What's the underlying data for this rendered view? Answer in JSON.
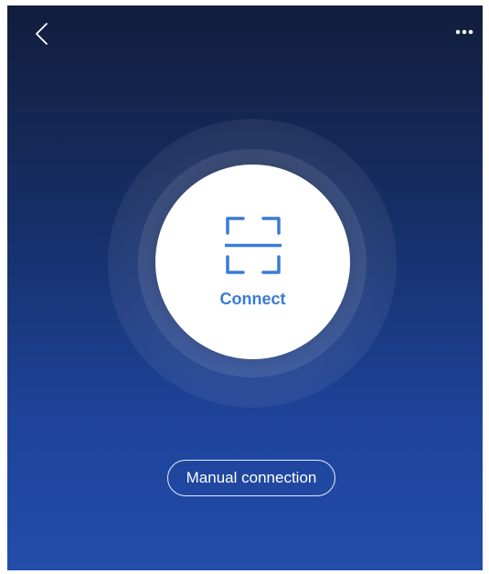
{
  "header": {
    "back_icon": "chevron-left-icon",
    "more_icon": "more-horizontal-icon"
  },
  "main": {
    "scan_icon": "scan-frame-icon",
    "connect_label": "Connect",
    "manual_connection_label": "Manual connection"
  },
  "colors": {
    "background_top": "#111d3c",
    "background_bottom": "#224da9",
    "accent": "#3a7bd5",
    "button_fill": "#ffffff"
  }
}
